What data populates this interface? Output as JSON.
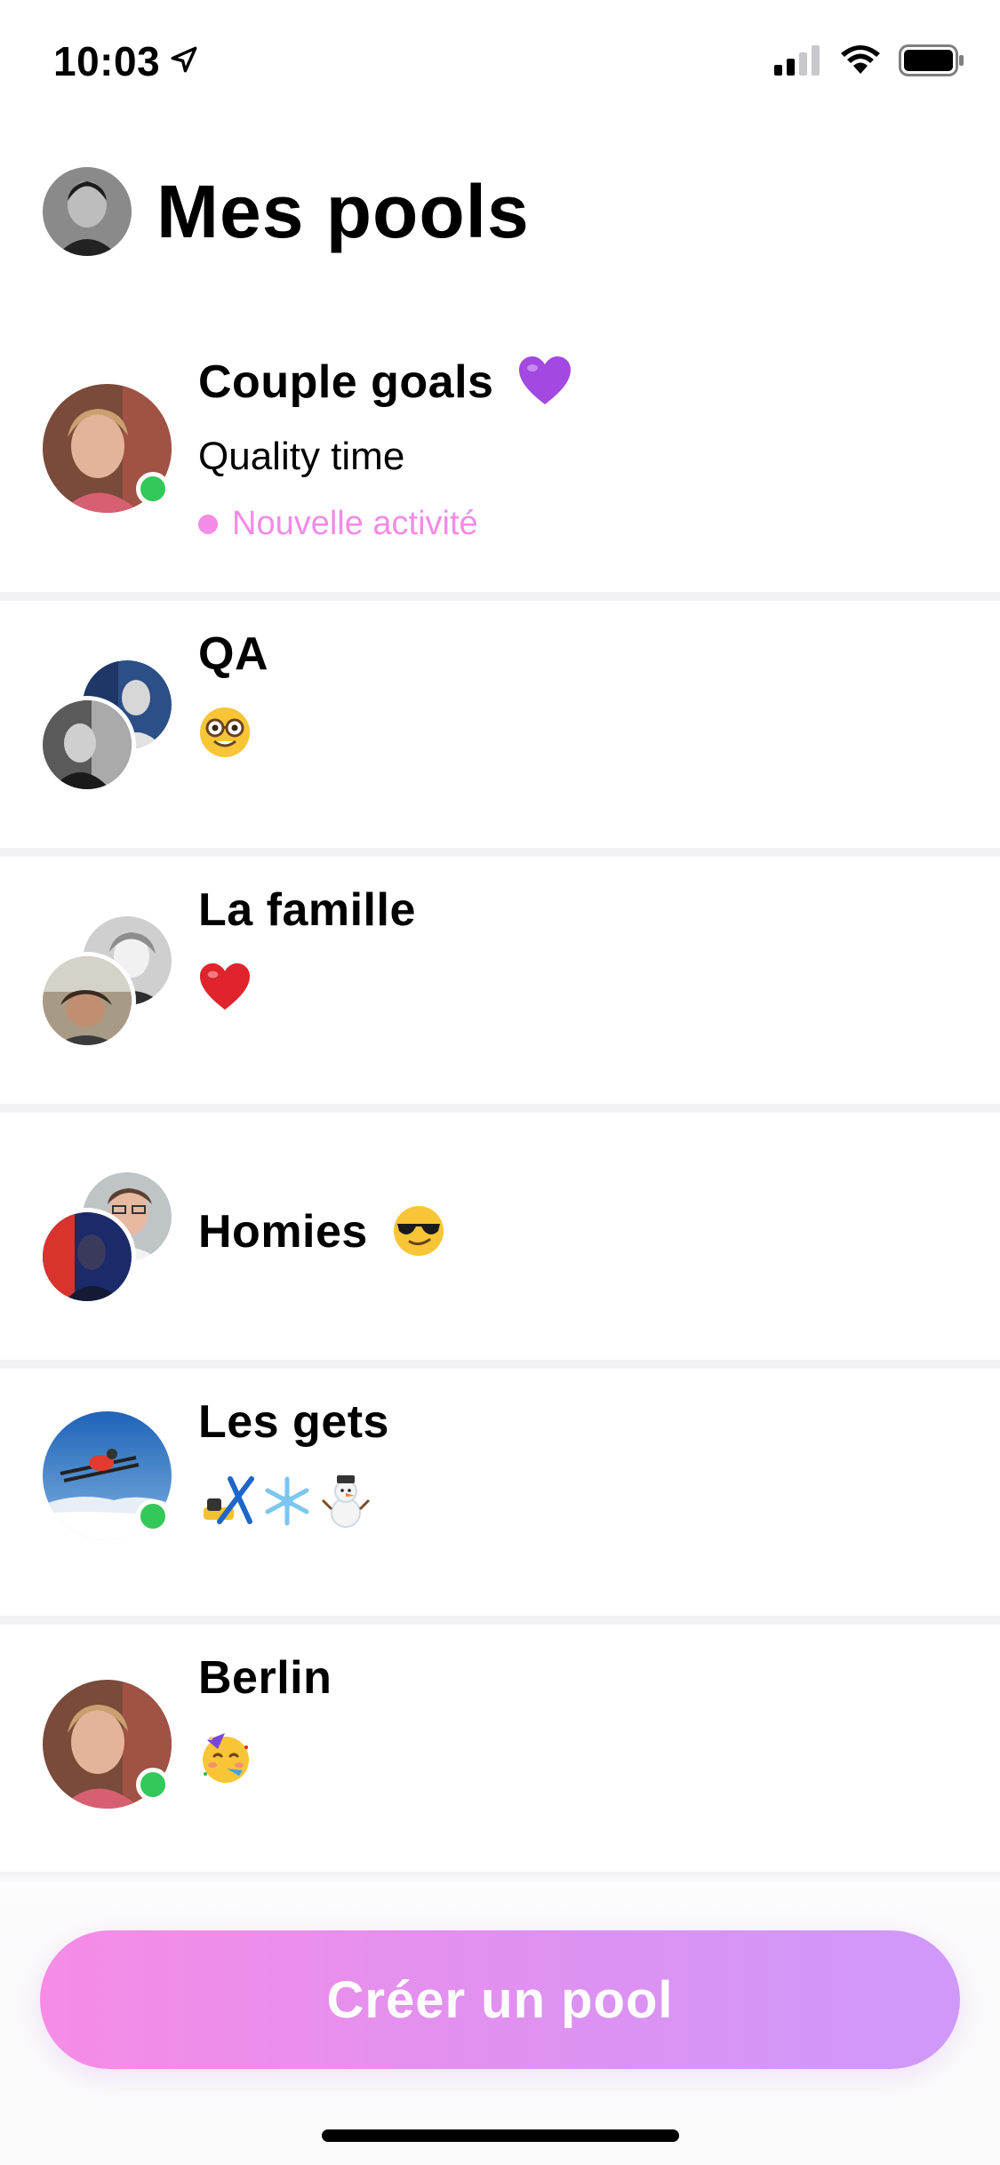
{
  "status_bar": {
    "time": "10:03",
    "icons": [
      "location-arrow-icon",
      "cellular-signal-icon",
      "wifi-icon",
      "battery-icon"
    ]
  },
  "header": {
    "title": "Mes pools",
    "avatar": "profile-avatar"
  },
  "pools": [
    {
      "name": "Couple goals",
      "name_emoji": "purple-heart-emoji",
      "subtitle": "Quality time",
      "activity": "Nouvelle activité",
      "online": true
    },
    {
      "name": "QA",
      "subtitle_emoji": "nerd-face-emoji",
      "online": false
    },
    {
      "name": "La famille",
      "subtitle_emoji": "red-heart-emoji",
      "online": false
    },
    {
      "name": "Homies",
      "name_emoji": "sunglasses-face-emoji",
      "online": false
    },
    {
      "name": "Les gets",
      "subtitle_emoji": "ski-snowflake-snowman-emoji",
      "online": true
    },
    {
      "name": "Berlin",
      "subtitle_emoji": "party-face-emoji",
      "online": true
    }
  ],
  "create_button": {
    "label": "Créer un pool"
  },
  "colors": {
    "accent_pink": "#f48be5",
    "button_gradient_start": "#f68ce6",
    "button_gradient_end": "#cf99f9",
    "online_green": "#34c759",
    "divider": "#f2f2f4"
  }
}
